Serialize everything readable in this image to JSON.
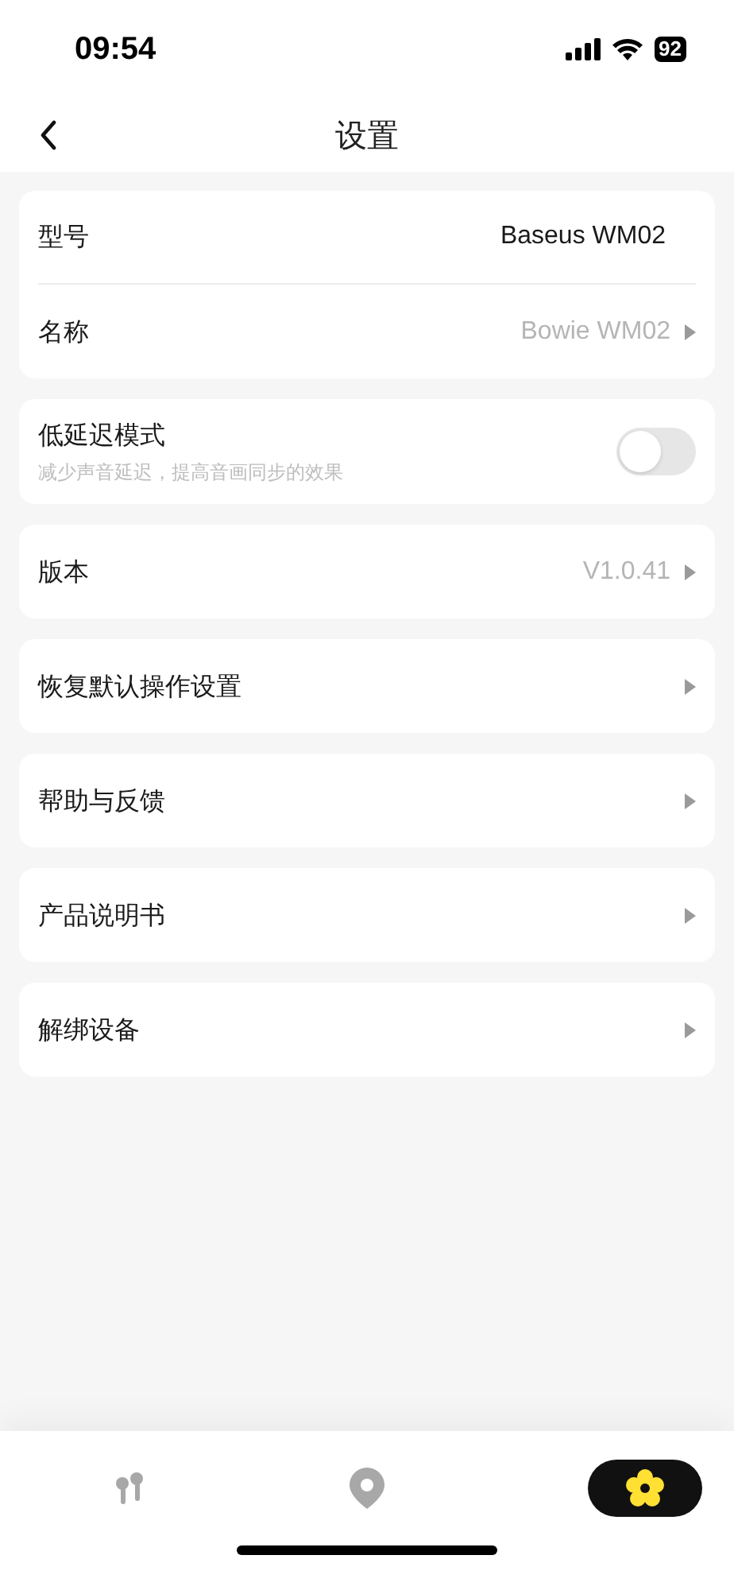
{
  "status_bar": {
    "time": "09:54",
    "battery": "92"
  },
  "nav": {
    "title": "设置"
  },
  "groups": [
    {
      "rows": [
        {
          "kind": "info",
          "label": "型号",
          "value": "Baseus WM02",
          "arrow": false
        },
        {
          "kind": "info",
          "label": "名称",
          "value": "Bowie WM02",
          "arrow": true
        }
      ]
    },
    {
      "rows": [
        {
          "kind": "toggle",
          "label": "低延迟模式",
          "subtitle": "减少声音延迟，提高音画同步的效果",
          "on": false
        }
      ]
    },
    {
      "rows": [
        {
          "kind": "info",
          "label": "版本",
          "value": "V1.0.41",
          "arrow": true
        }
      ]
    },
    {
      "rows": [
        {
          "kind": "info",
          "label": "恢复默认操作设置",
          "arrow": true
        }
      ]
    },
    {
      "rows": [
        {
          "kind": "info",
          "label": "帮助与反馈",
          "arrow": true
        }
      ]
    },
    {
      "rows": [
        {
          "kind": "info",
          "label": "产品说明书",
          "arrow": true
        }
      ]
    },
    {
      "rows": [
        {
          "kind": "info",
          "label": "解绑设备",
          "arrow": true
        }
      ]
    }
  ],
  "tabs": [
    {
      "kind": "earbuds",
      "selected": false
    },
    {
      "kind": "location",
      "selected": false
    },
    {
      "kind": "settings",
      "selected": true
    }
  ]
}
